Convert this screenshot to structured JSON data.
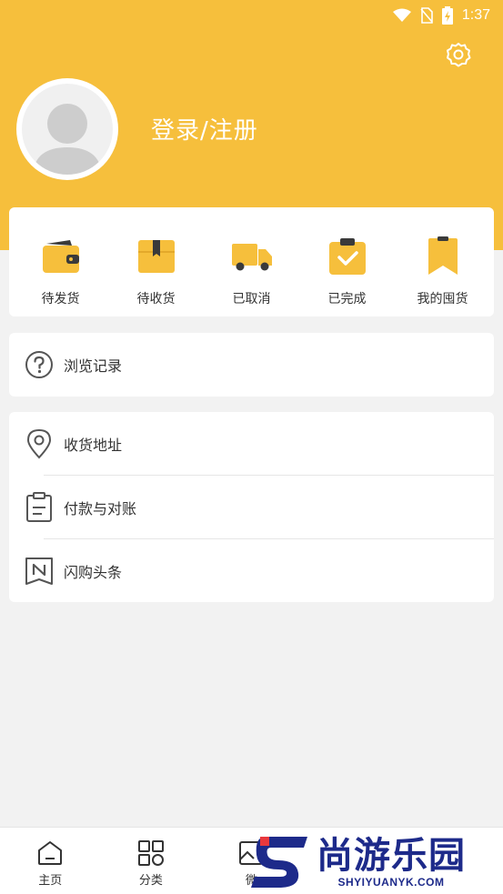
{
  "status_bar": {
    "time": "1:37"
  },
  "profile": {
    "login_text": "登录/注册"
  },
  "orders": [
    {
      "label": "待发货",
      "icon": "wallet-icon"
    },
    {
      "label": "待收货",
      "icon": "box-icon"
    },
    {
      "label": "已取消",
      "icon": "truck-icon"
    },
    {
      "label": "已完成",
      "icon": "clipboard-check-icon"
    },
    {
      "label": "我的囤货",
      "icon": "bookmark-icon"
    }
  ],
  "history": {
    "label": "浏览记录",
    "icon": "question-circle-icon"
  },
  "menu": [
    {
      "label": "收货地址",
      "icon": "location-pin-icon"
    },
    {
      "label": "付款与对账",
      "icon": "clipboard-list-icon"
    },
    {
      "label": "闪购头条",
      "icon": "news-n-icon"
    }
  ],
  "tabs": [
    {
      "label": "主页",
      "icon": "home-icon"
    },
    {
      "label": "分类",
      "icon": "grid-icon"
    },
    {
      "label": "微",
      "icon": "image-icon"
    }
  ],
  "watermark": {
    "cn": "尚游乐园",
    "en": "SHYIYUANYK.COM"
  },
  "colors": {
    "brand": "#f6bf3c",
    "icon_yellow": "#f6bf3c",
    "icon_dark": "#3a3a3a",
    "watermark": "#1d2a8a"
  }
}
